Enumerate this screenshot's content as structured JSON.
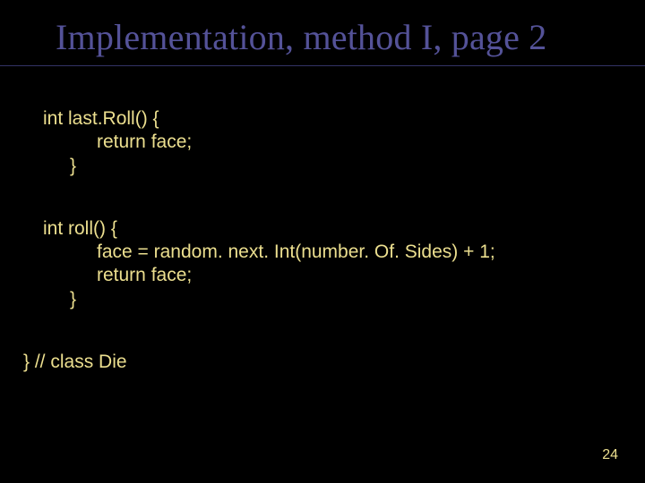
{
  "title": "Implementation, method I, page 2",
  "block1": {
    "l1": "int last.Roll() {",
    "l2": "return face;",
    "l3": "}"
  },
  "block2": {
    "l1": "int roll() {",
    "l2": "face = random. next. Int(number. Of. Sides) + 1;",
    "l3": "return face;",
    "l4": "}"
  },
  "block3": {
    "l1": "} // class Die"
  },
  "slideNumber": "24"
}
